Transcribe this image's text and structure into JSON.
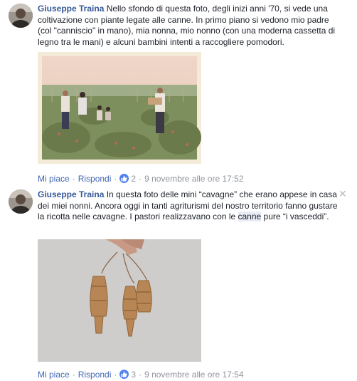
{
  "comments": [
    {
      "author": "Giuseppe Traina",
      "text": "Nello sfondo di questa foto, degli inizi anni '70, si vede una coltivazione con piante legate alle canne. In primo piano si vedono mio padre (col \"canniscio\" in mano), mia nonna, mio nonno (con una moderna cassetta di legno tra le mani) e alcuni bambini intenti a raccogliere pomodori.",
      "like_label": "Mi piace",
      "reply_label": "Rispondi",
      "reaction_count": "2",
      "timestamp": "9 novembre alle ore 17:52"
    },
    {
      "author": "Giuseppe Traina",
      "text_before": "In questa foto delle mini “cavagne” che erano appese in casa dei miei nonni. Ancora oggi in tanti agriturismi del nostro territorio fanno gustare la ricotta nelle cavagne. I pastori realizzavano con le ",
      "text_highlight": "canne",
      "text_after": " pure “i vasceddi”.",
      "like_label": "Mi piace",
      "reply_label": "Rispondi",
      "reaction_count": "3",
      "timestamp": "9 novembre alle ore 17:54",
      "close_symbol": "✕"
    }
  ],
  "colors": {
    "author": "#365899",
    "link": "#4267b2",
    "meta": "#90949c",
    "like_badge": "#4f81f4",
    "highlight_bg": "#e7ecf6"
  },
  "icons": [
    "avatar",
    "like-thumb-icon",
    "close-icon"
  ]
}
